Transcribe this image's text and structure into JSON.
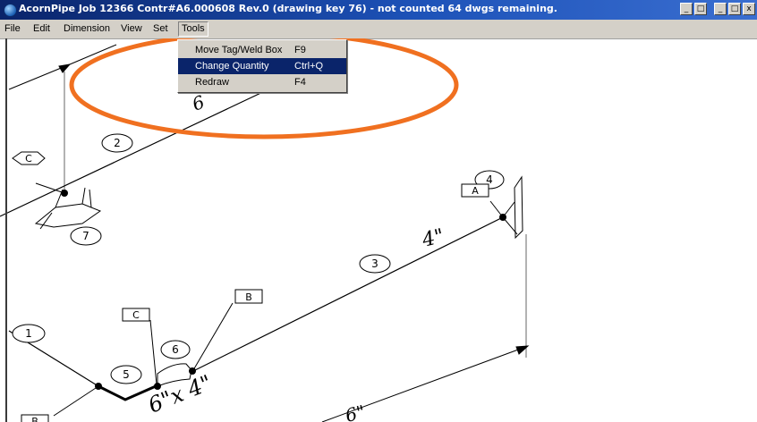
{
  "window": {
    "title": "AcornPipe Job 12366     Contr#A6.000608 Rev.0  (drawing key 76) - not counted  64 dwgs remaining.",
    "buttons": [
      "_",
      "□",
      "_",
      "□",
      "x"
    ]
  },
  "menubar": {
    "items": [
      "File",
      "Edit",
      "Dimension",
      "View",
      "Set",
      "Tools"
    ]
  },
  "tools_menu": {
    "items": [
      {
        "label": "Move Tag/Weld Box",
        "shortcut": "F9"
      },
      {
        "label": "Change Quantity",
        "shortcut": "Ctrl+Q"
      },
      {
        "label": "Redraw",
        "shortcut": "F4"
      }
    ],
    "highlighted_index": 1
  },
  "drawing": {
    "circle_labels": [
      "2",
      "7",
      "4",
      "3",
      "1",
      "5",
      "6"
    ],
    "box_labels": [
      "C",
      "A",
      "B",
      "C",
      "B"
    ],
    "handwritten": [
      "6",
      "4\"",
      "6\"x 4\"",
      "6\""
    ],
    "annotation_color": "#f07020",
    "line_color": "#000000"
  }
}
